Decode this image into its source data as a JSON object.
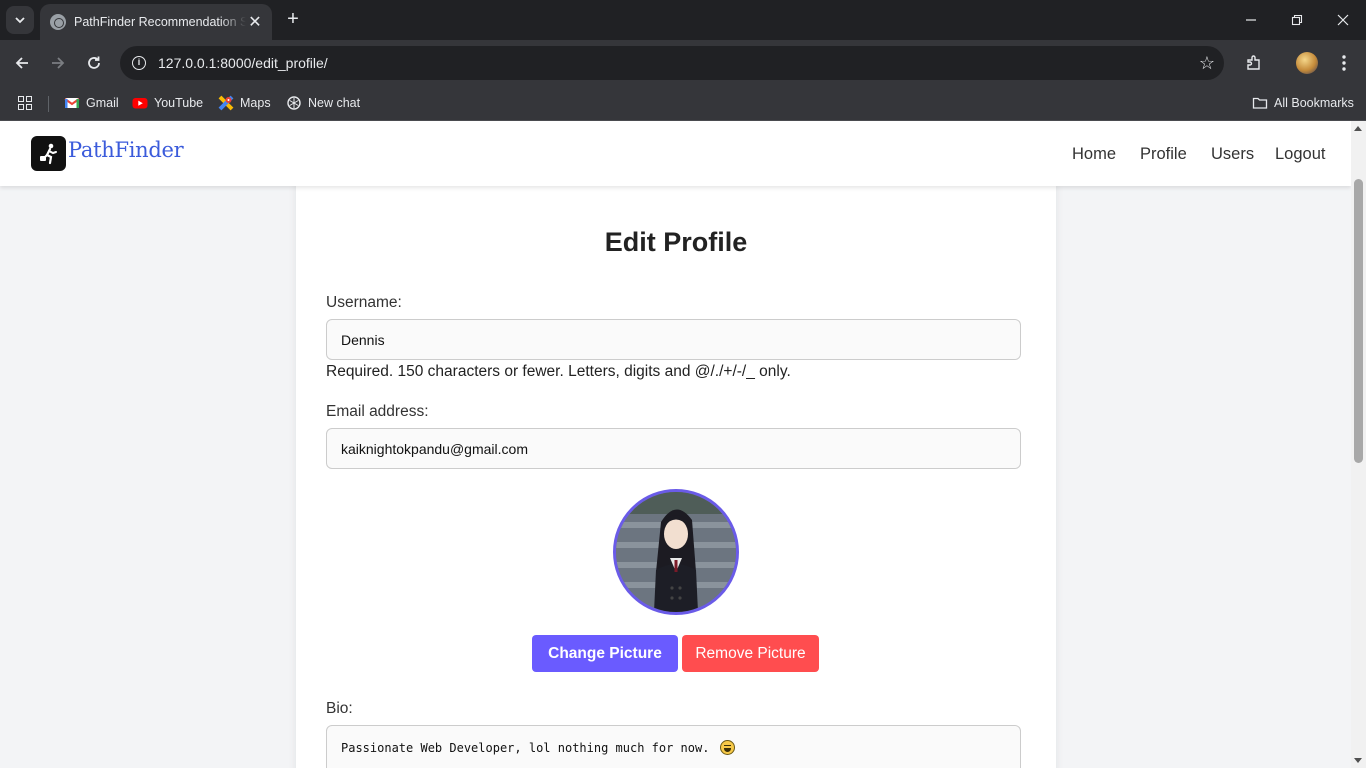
{
  "browser": {
    "tab_title": "PathFinder Recommendation System",
    "url": "127.0.0.1:8000/edit_profile/",
    "bookmarks": [
      {
        "label": "Gmail",
        "icon": "gmail-icon"
      },
      {
        "label": "YouTube",
        "icon": "youtube-icon"
      },
      {
        "label": "Maps",
        "icon": "maps-icon"
      },
      {
        "label": "New chat",
        "icon": "chatgpt-icon"
      }
    ],
    "all_bookmarks_label": "All Bookmarks"
  },
  "site": {
    "brand": "PathFinder",
    "nav": [
      {
        "label": "Home"
      },
      {
        "label": "Profile"
      },
      {
        "label": "Users"
      },
      {
        "label": "Logout"
      }
    ]
  },
  "form": {
    "title": "Edit Profile",
    "username": {
      "label": "Username:",
      "value": "Dennis",
      "help": "Required. 150 characters or fewer. Letters, digits and @/./+/-/_ only."
    },
    "email": {
      "label": "Email address:",
      "value": "kaiknightokpandu@gmail.com"
    },
    "buttons": {
      "change_picture": "Change Picture",
      "remove_picture": "Remove Picture"
    },
    "bio": {
      "label": "Bio:",
      "value": "Passionate Web Developer, lol nothing much for now."
    }
  },
  "colors": {
    "accent": "#6a5bff",
    "danger": "#ff4d4f",
    "brand_text": "#3b5bdb"
  }
}
